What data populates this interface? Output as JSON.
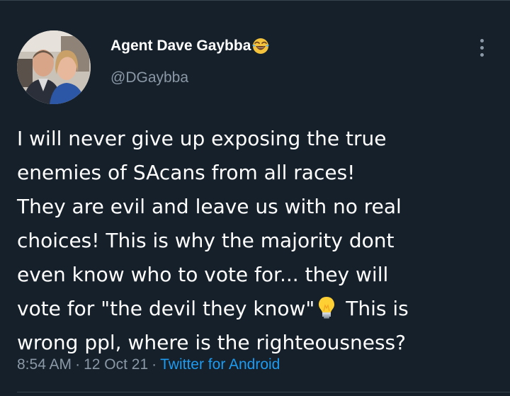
{
  "author": {
    "display_name": "Agent Dave Gaybba",
    "name_emoji": "face-with-tears-of-joy-icon",
    "handle": "@DGaybba"
  },
  "tweet": {
    "lines": [
      "I will never give up exposing the true",
      "enemies of SAcans from all races!",
      "They are evil and leave us with no real",
      "choices! This is why the majority dont",
      "even know who to vote for... they will",
      "vote for \"the devil they know\"",
      "wrong ppl, where is the righteousness?"
    ],
    "line6_after_emoji": "This is",
    "inline_emoji": "light-bulb-icon"
  },
  "meta": {
    "time": "8:54 AM",
    "separator": "·",
    "date": "12 Oct 21",
    "source": "Twitter for Android"
  },
  "colors": {
    "background": "#15202b",
    "text": "#ffffff",
    "secondary": "#8b98a5",
    "link": "#1d9bf0",
    "divider": "#38444d"
  }
}
